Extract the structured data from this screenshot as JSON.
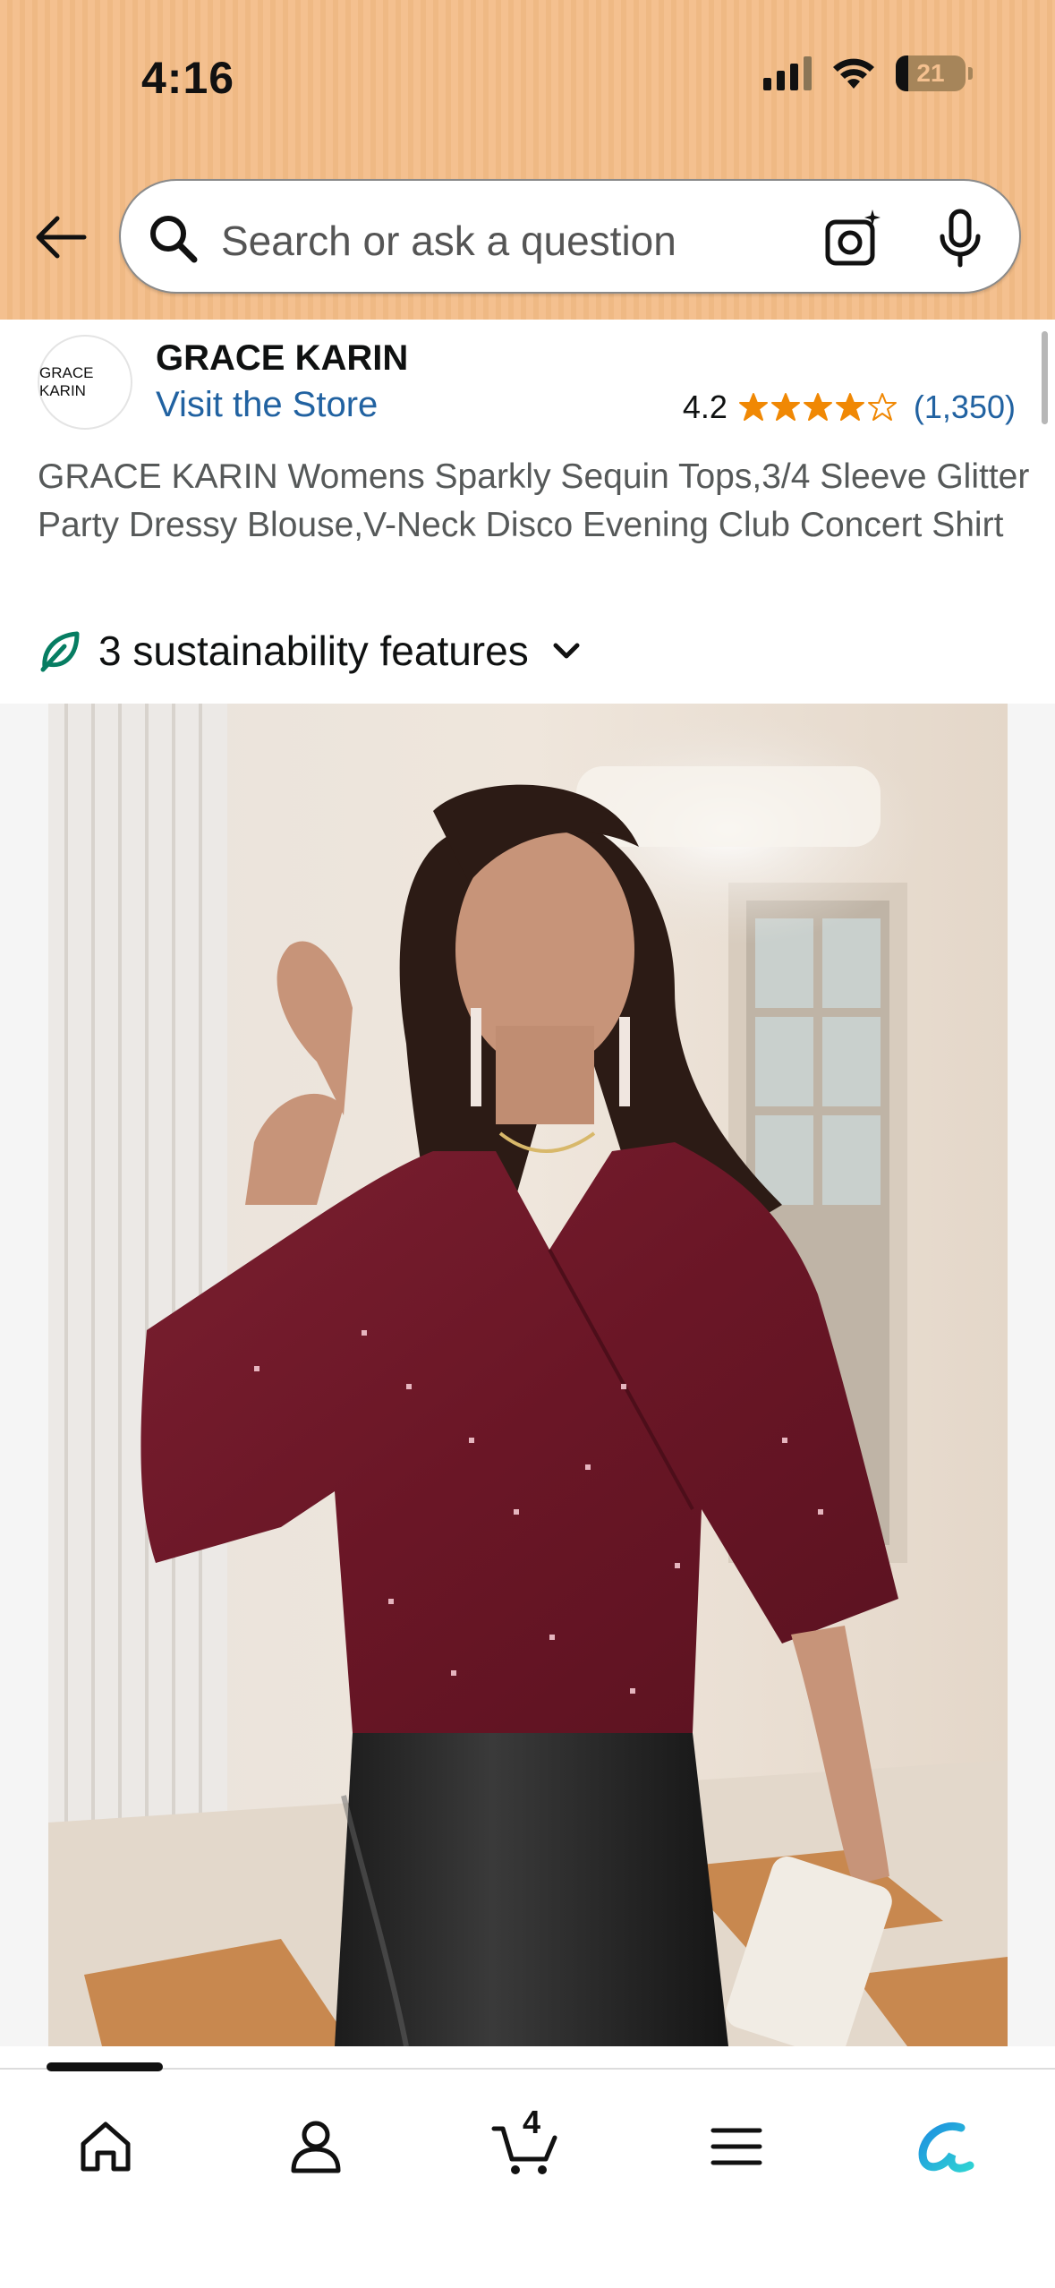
{
  "status_bar": {
    "time": "4:16",
    "battery": "21"
  },
  "search": {
    "placeholder": "Search or ask a question"
  },
  "store": {
    "logo_text": "GRACE KARIN",
    "name": "GRACE KARIN",
    "visit_link": "Visit the Store",
    "rating": "4.2",
    "stars_filled": 4,
    "review_count": "(1,350)"
  },
  "product": {
    "title": "GRACE KARIN Womens Sparkly Sequin Tops,3/4 Sleeve Glitter Party Dressy Blouse,V-Neck Disco Evening Club Concert Shirt",
    "sustainability": "3 sustainability features"
  },
  "bottom_nav": {
    "items": [
      "home-icon",
      "account-icon",
      "cart-icon",
      "menu-icon",
      "rufus-icon"
    ],
    "cart_count": "4"
  },
  "colors": {
    "header_bg": "#f4c08f",
    "link": "#2162a1",
    "star": "#f08804",
    "leaf": "#067d62",
    "product_color": "#6e1a2a"
  }
}
